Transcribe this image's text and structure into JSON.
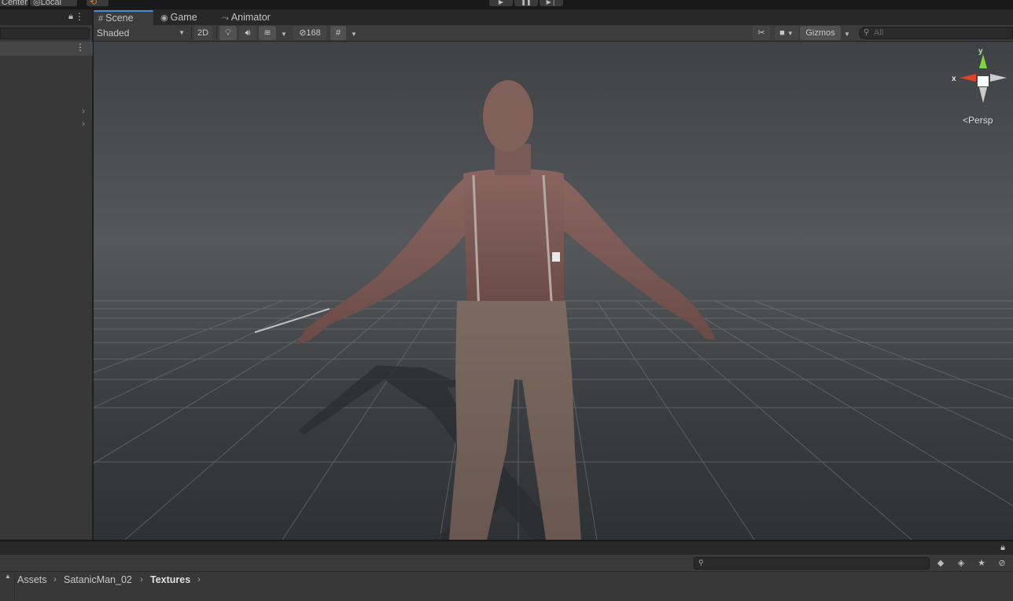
{
  "top": {
    "pivot_label": "Center",
    "space_label": "Local",
    "play_icons": [
      "play-icon",
      "pause-icon",
      "step-icon"
    ]
  },
  "scene_tabs": [
    {
      "label": "Scene",
      "icon": "grid-icon"
    },
    {
      "label": "Game",
      "icon": "gamepad-icon"
    },
    {
      "label": "Animator",
      "icon": "animator-icon"
    }
  ],
  "scene_toolbar": {
    "draw_mode": "Shaded",
    "two_d_label": "2D",
    "hidden_count": "168",
    "gizmos_label": "Gizmos",
    "search_placeholder": "All"
  },
  "gizmo": {
    "x_label": "x",
    "y_label": "y",
    "projection_label": "Persp"
  },
  "project": {
    "search_value": "",
    "breadcrumb": [
      "Assets",
      "SatanicMan_02",
      "Textures"
    ]
  },
  "colors": {
    "axis_x": "#e0412a",
    "axis_y": "#7fd63b",
    "active_tab": "#4a8ad8"
  }
}
